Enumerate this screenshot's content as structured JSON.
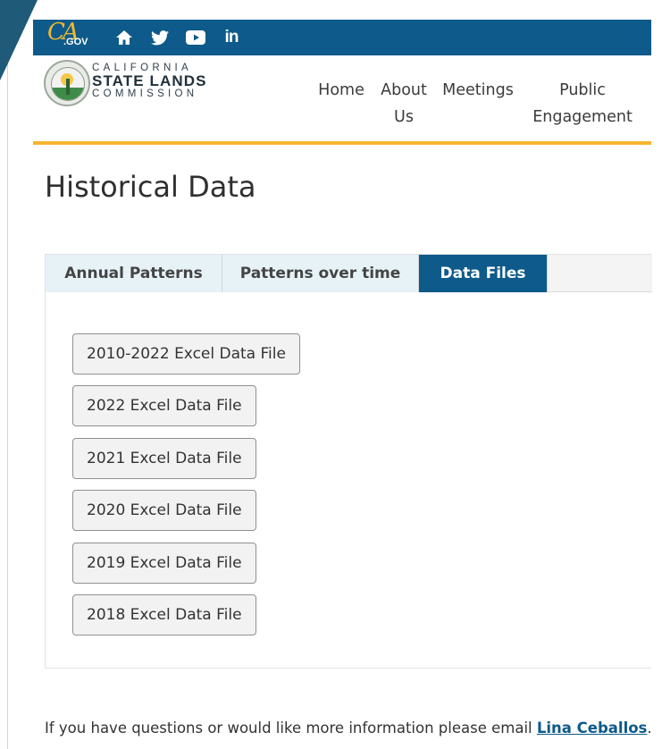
{
  "utility_bar": {
    "logo_text": "CA",
    "logo_suffix": ".GOV",
    "icons": [
      "home-icon",
      "twitter-icon",
      "youtube-icon",
      "linkedin-icon"
    ]
  },
  "header": {
    "org_line1": "CALIFORNIA",
    "org_line2": "STATE LANDS",
    "org_line3": "COMMISSION",
    "nav": [
      {
        "label_line1": "Home",
        "label_line2": ""
      },
      {
        "label_line1": "About",
        "label_line2": "Us"
      },
      {
        "label_line1": "Meetings",
        "label_line2": ""
      },
      {
        "label_line1": "Public",
        "label_line2": "Engagement"
      }
    ]
  },
  "page": {
    "title": "Historical Data"
  },
  "tabs": [
    {
      "label": "Annual Patterns",
      "active": false
    },
    {
      "label": "Patterns over time",
      "active": false
    },
    {
      "label": "Data Files",
      "active": true
    }
  ],
  "data_files": [
    {
      "label": "2010-2022 Excel Data File"
    },
    {
      "label": "2022 Excel Data File"
    },
    {
      "label": "2021 Excel Data File"
    },
    {
      "label": "2020 Excel Data File"
    },
    {
      "label": "2019 Excel Data File"
    },
    {
      "label": "2018 Excel Data File"
    }
  ],
  "footer": {
    "contact_text": "If you have questions or would like more information please email ",
    "contact_name": "Lina Ceballos",
    "contact_end": "."
  },
  "colors": {
    "brand_blue": "#0e5a8a",
    "accent_gold": "#f5b52e",
    "tab_inactive": "#e7f2f7"
  }
}
